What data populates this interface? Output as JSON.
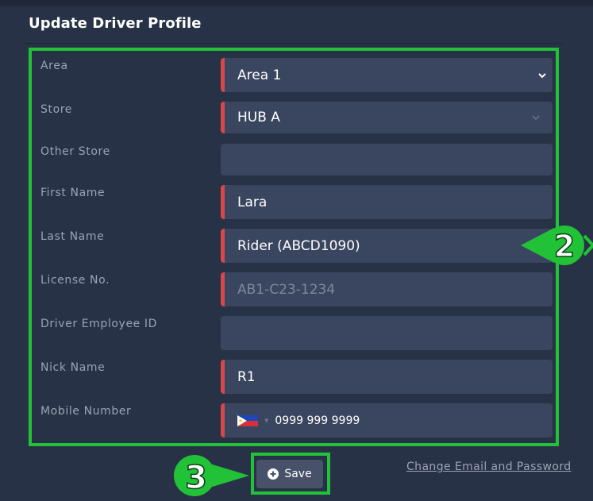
{
  "panel": {
    "title": "Update Driver Profile"
  },
  "form": {
    "area": {
      "label": "Area",
      "value": "Area 1"
    },
    "store": {
      "label": "Store",
      "value": "HUB A"
    },
    "other_store": {
      "label": "Other Store",
      "value": ""
    },
    "first_name": {
      "label": "First Name",
      "value": "Lara"
    },
    "last_name": {
      "label": "Last Name",
      "value": "Rider (ABCD1090)"
    },
    "license_no": {
      "label": "License No.",
      "placeholder": "AB1-C23-1234"
    },
    "employee_id": {
      "label": "Driver Employee ID",
      "value": ""
    },
    "nick_name": {
      "label": "Nick Name",
      "value": "R1"
    },
    "mobile": {
      "label": "Mobile Number",
      "value": "0999 999 9999",
      "country_flag": "philippines-flag"
    }
  },
  "actions": {
    "save_label": "Save",
    "change_link": "Change Email and Password"
  },
  "callouts": {
    "step_2": "2",
    "step_3": "3"
  },
  "colors": {
    "background": "#283246",
    "field": "#3a4660",
    "required_marker": "#d8474b",
    "highlight": "#22c238",
    "label": "#9aa3b5"
  }
}
